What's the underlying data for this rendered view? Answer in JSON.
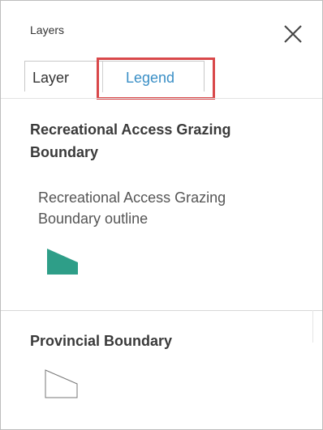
{
  "panel": {
    "title": "Layers",
    "close_icon": "close-icon"
  },
  "tabs": [
    {
      "label": "Layer",
      "active": false
    },
    {
      "label": "Legend",
      "active": true
    }
  ],
  "colors": {
    "active_tab_text": "#3a8fc6",
    "highlight_border": "#d9484a",
    "fill_swatch": "#2e9e88"
  },
  "legend": [
    {
      "layer_title": "Recreational Access Grazing Boundary",
      "items": [
        {
          "label": "Recreational Access Grazing Boundary outline",
          "symbol": "filled-polygon",
          "color": "#2e9e88"
        }
      ]
    },
    {
      "layer_title": "Provincial Boundary",
      "items": [
        {
          "label": "",
          "symbol": "outline-polygon",
          "color": "#ffffff"
        }
      ]
    }
  ]
}
